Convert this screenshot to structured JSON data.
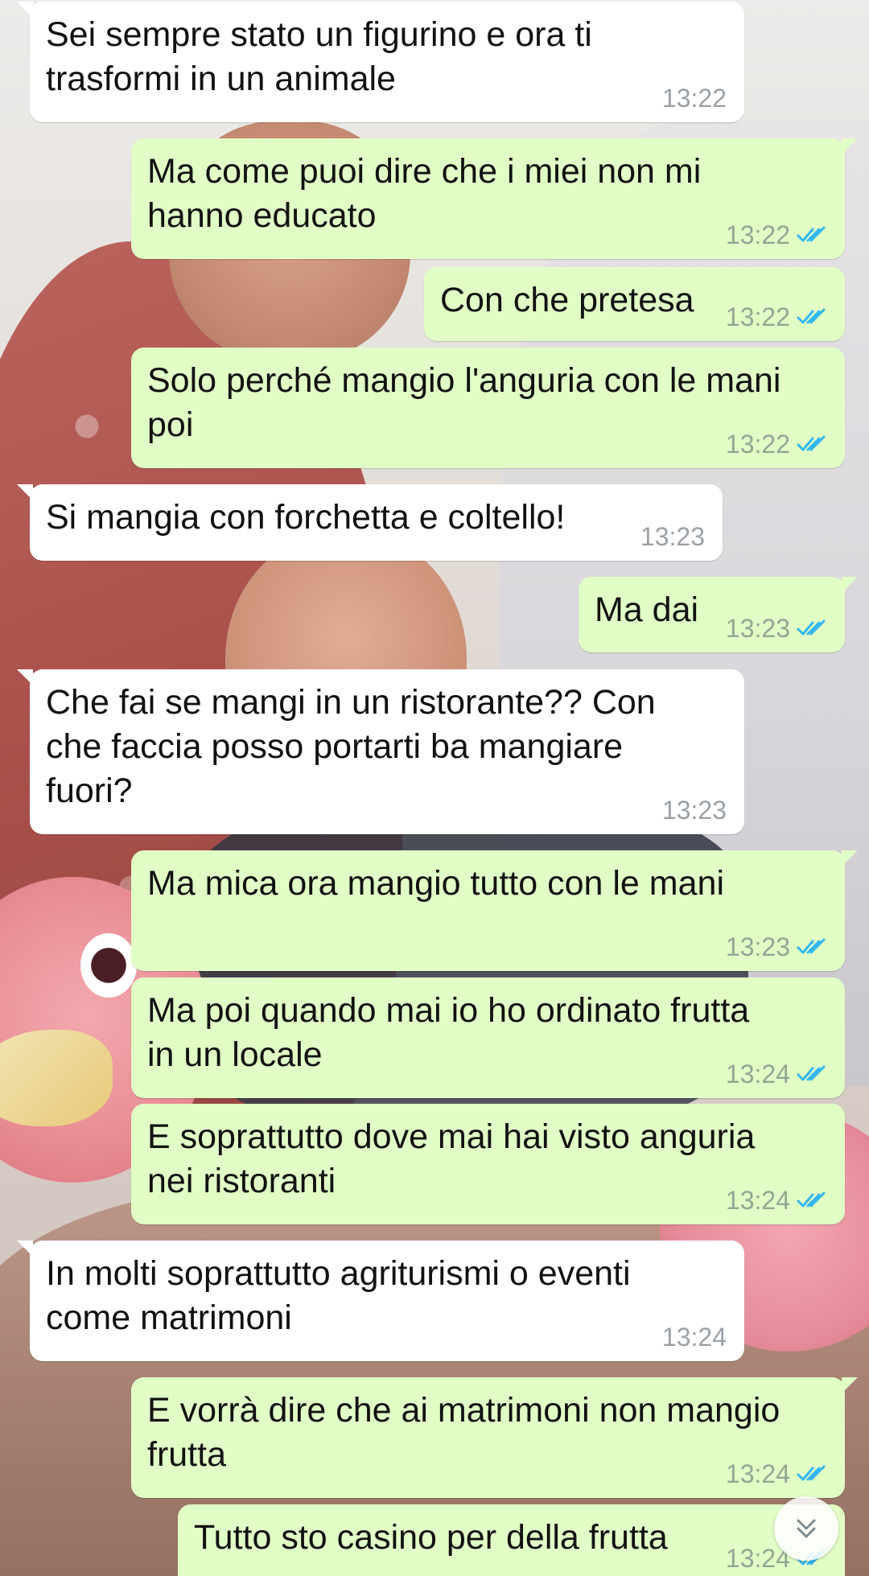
{
  "app": "WhatsApp",
  "colors": {
    "incoming_bubble": "#ffffff",
    "outgoing_bubble": "#e1fec6",
    "read_tick": "#34b7f1"
  },
  "messages": [
    {
      "direction": "in",
      "text": "Sei sempre stato un figurino e ora ti\ntrasformi in un animale",
      "time": "13:22",
      "status": ""
    },
    {
      "direction": "out",
      "text": "Ma come puoi dire che i miei non mi\nhanno educato",
      "time": "13:22",
      "status": "read"
    },
    {
      "direction": "out",
      "text": "Con che pretesa",
      "time": "13:22",
      "status": "read"
    },
    {
      "direction": "out",
      "text": "Solo perché mangio l'anguria con le mani\npoi",
      "time": "13:22",
      "status": "read"
    },
    {
      "direction": "in",
      "text": "Si mangia con forchetta e coltello!",
      "time": "13:23",
      "status": ""
    },
    {
      "direction": "out",
      "text": "Ma dai",
      "time": "13:23",
      "status": "read"
    },
    {
      "direction": "in",
      "text": "Che fai se mangi in un ristorante?? Con\nche faccia posso portarti ba mangiare\nfuori?",
      "time": "13:23",
      "status": ""
    },
    {
      "direction": "out",
      "text": "Ma mica ora mangio tutto con le mani",
      "time": "13:23",
      "status": "read"
    },
    {
      "direction": "out",
      "text": "Ma poi quando mai io ho ordinato frutta\nin un locale",
      "time": "13:24",
      "status": "read"
    },
    {
      "direction": "out",
      "text": "E soprattutto dove mai hai visto anguria\nnei ristoranti",
      "time": "13:24",
      "status": "read"
    },
    {
      "direction": "in",
      "text": "In molti soprattutto agriturismi o eventi\ncome matrimoni",
      "time": "13:24",
      "status": ""
    },
    {
      "direction": "out",
      "text": "E vorrà dire che ai matrimoni non mangio\nfrutta",
      "time": "13:24",
      "status": "read"
    },
    {
      "direction": "out",
      "text": "Tutto sto casino per della frutta",
      "time": "13:24",
      "status": "read"
    }
  ],
  "icons": {
    "read_receipt": "double-check-icon",
    "scroll_down": "double-chevron-down-icon"
  }
}
